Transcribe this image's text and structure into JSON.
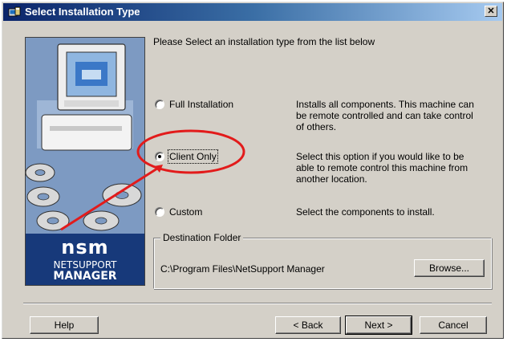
{
  "window": {
    "title": "Select Installation Type",
    "close_glyph": "✕"
  },
  "instruction": "Please Select an installation type from the list below",
  "options": [
    {
      "label": "Full Installation",
      "description": "Installs all components. This machine can be remote controlled and can take control of others.",
      "checked": false
    },
    {
      "label": "Client Only",
      "description": "Select this option if you would like to be able to remote control this machine from another location.",
      "checked": true
    },
    {
      "label": "Custom",
      "description": "Select the components to install.",
      "checked": false
    }
  ],
  "destination": {
    "legend": "Destination Folder",
    "path": "C:\\Program Files\\NetSupport Manager",
    "browse_label": "Browse..."
  },
  "logo": {
    "wordmark": "nsm",
    "line1": "NETSUPPORT",
    "line2": "MANAGER"
  },
  "buttons": {
    "help": "Help",
    "back": "< Back",
    "next": "Next >",
    "cancel": "Cancel"
  },
  "annotation_colors": {
    "circle": "#e21b1b",
    "arrow": "#e21b1b"
  },
  "icons": {
    "title_icon": "installer-icon",
    "close_icon": "close-icon"
  }
}
